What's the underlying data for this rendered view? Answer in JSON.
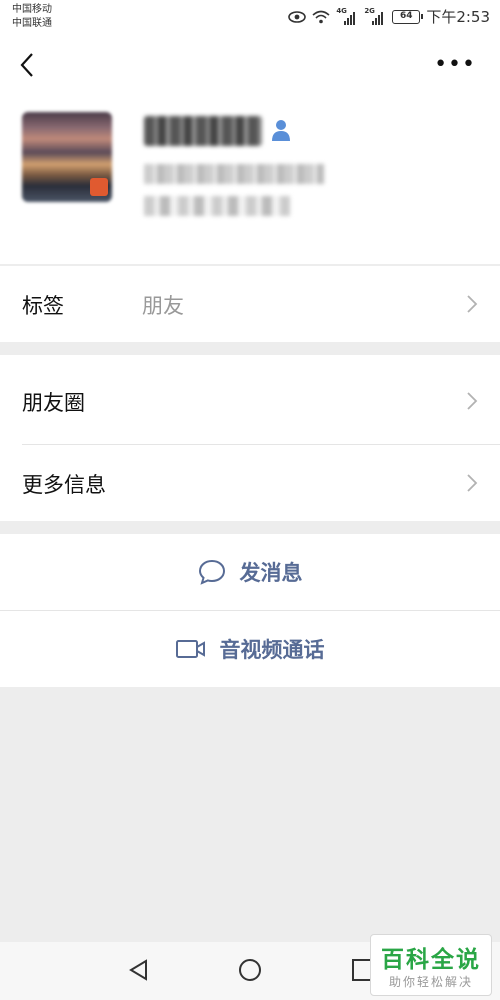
{
  "status_bar": {
    "carrier_1": "中国移动",
    "carrier_2": "中国联通",
    "signal_1_label": "4G",
    "signal_2_label": "2G",
    "battery": "64",
    "time": "下午2:53"
  },
  "profile": {
    "avatar": "blurred-avatar",
    "gender_icon": "male-person-icon"
  },
  "rows": {
    "tag_label": "标签",
    "tag_value": "朋友",
    "moments_label": "朋友圈",
    "more_info_label": "更多信息"
  },
  "actions": {
    "message_label": "发消息",
    "call_label": "音视频通话"
  },
  "colors": {
    "link": "#576b95",
    "background": "#ededed",
    "watermark_green": "#2aa646"
  },
  "watermark": {
    "title": "百科全说",
    "subtitle": "助你轻松解决"
  }
}
